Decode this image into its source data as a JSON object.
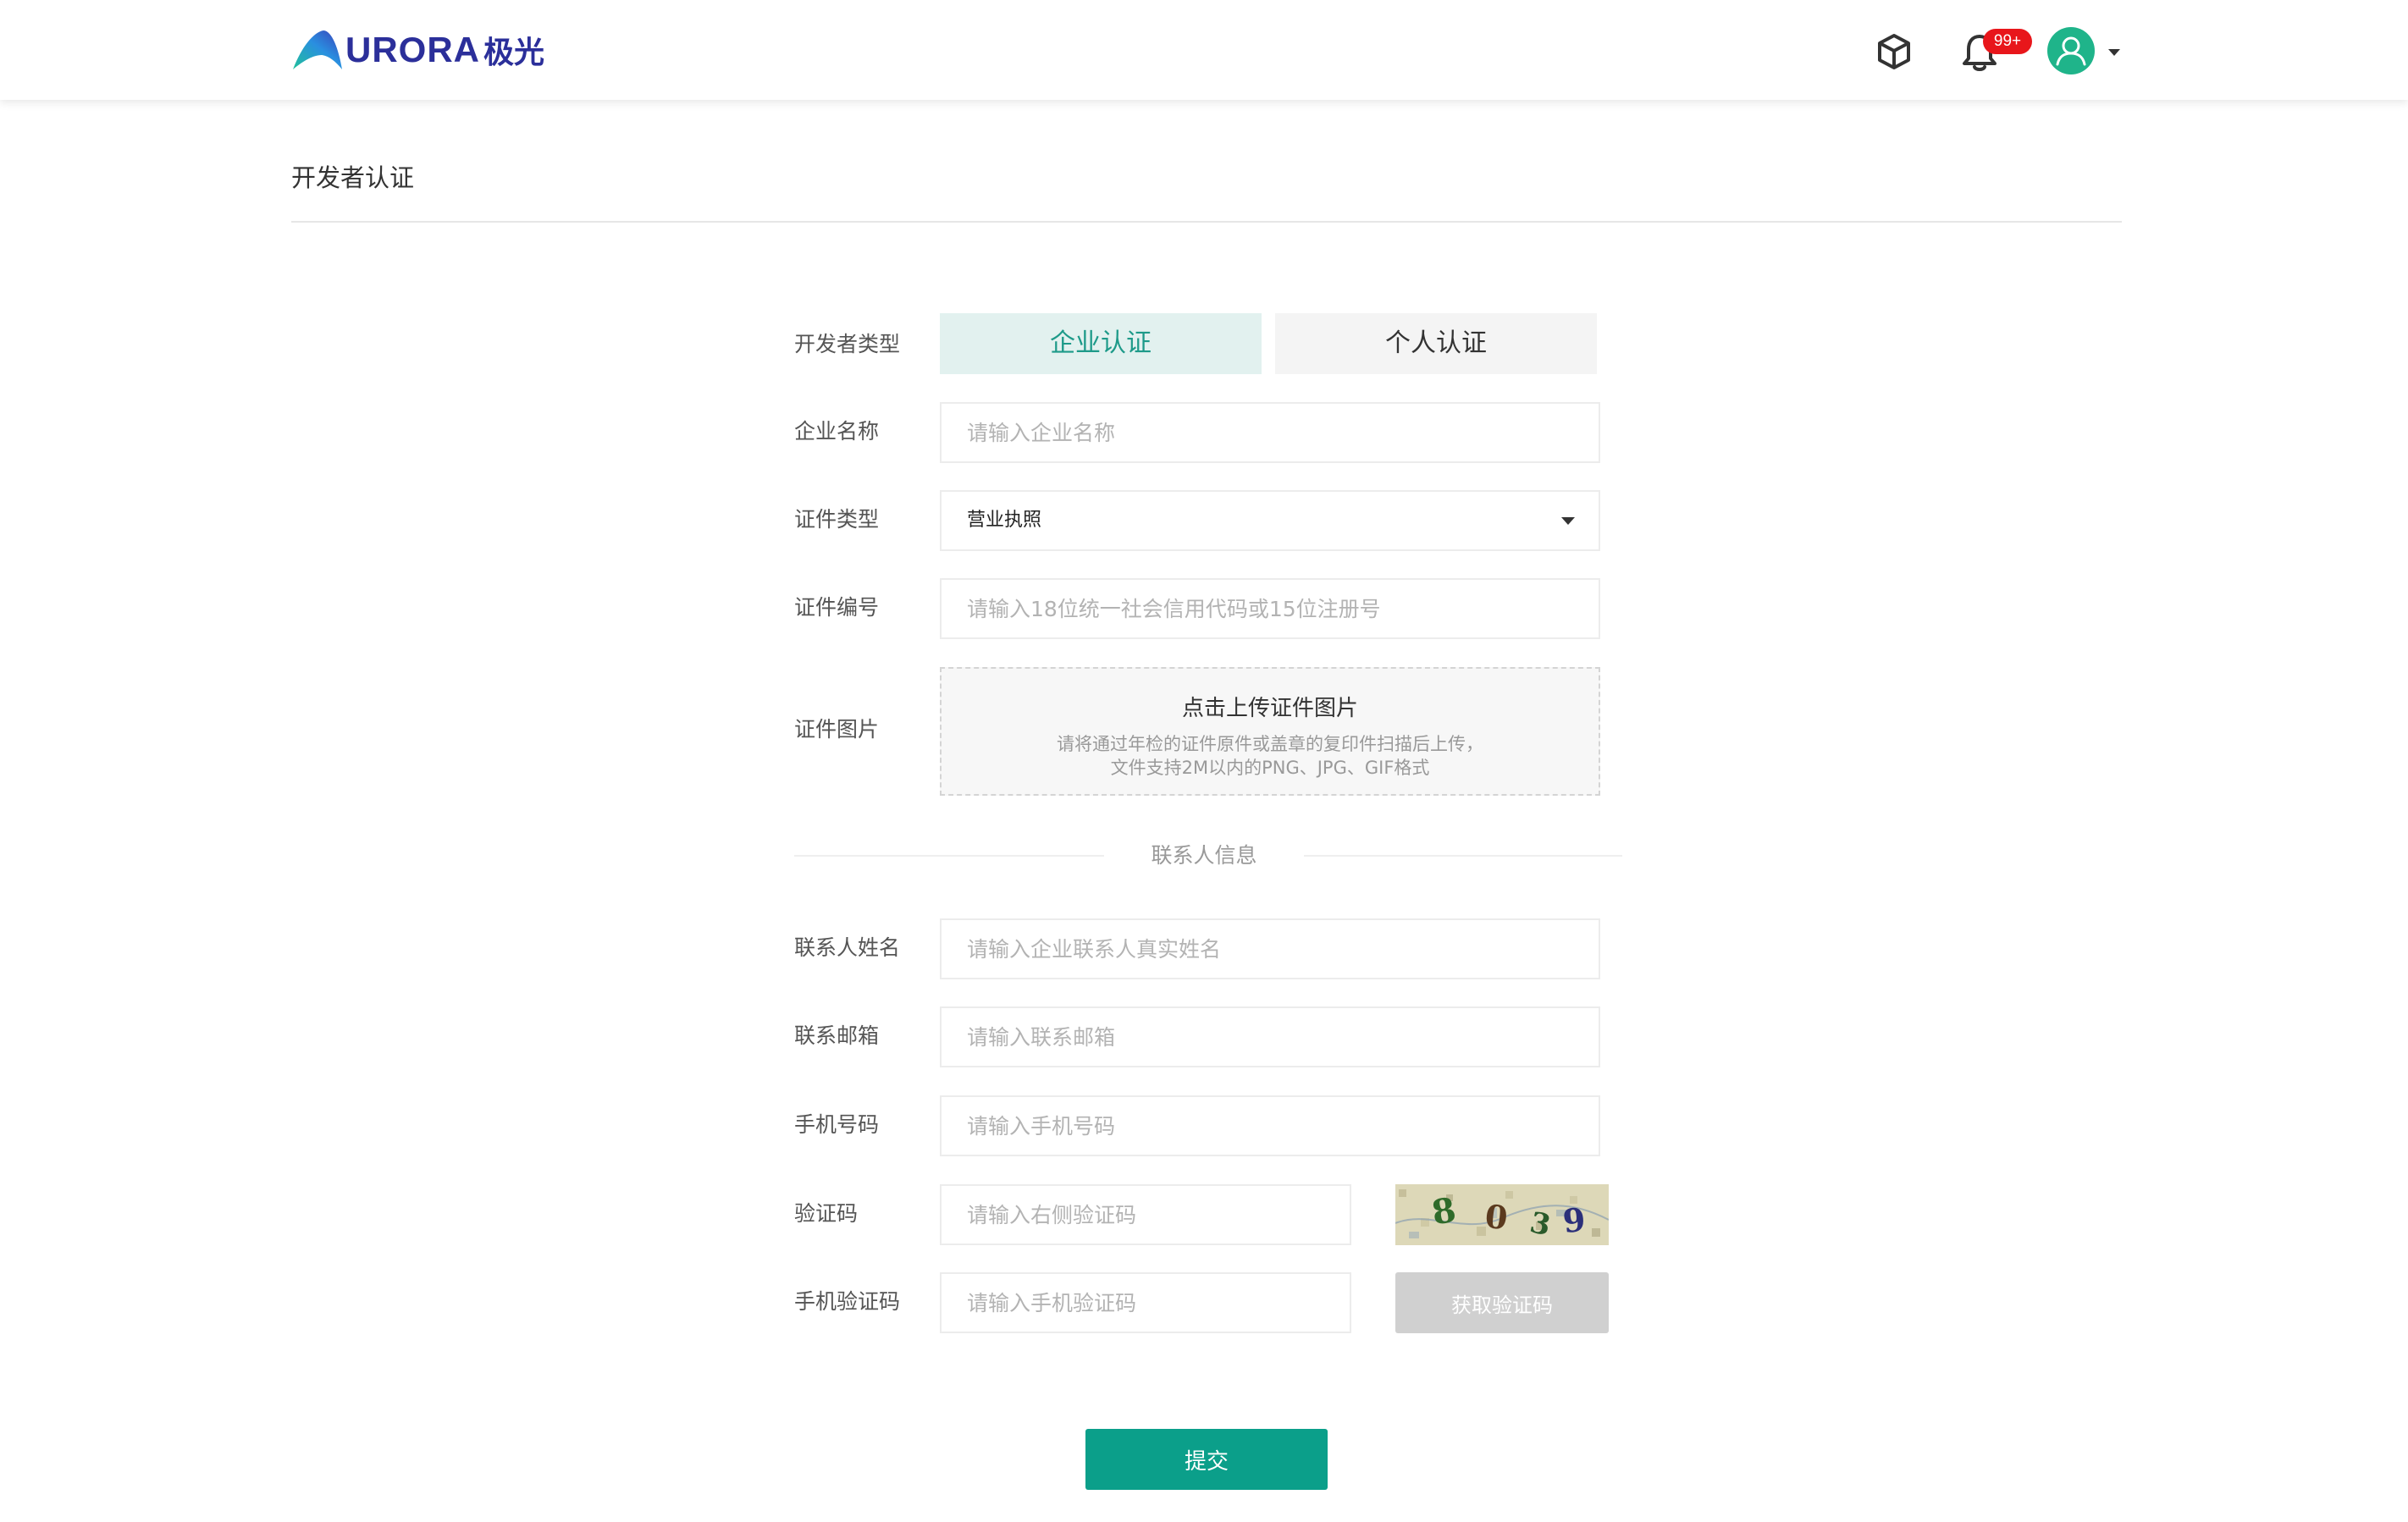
{
  "header": {
    "logo_word": "URORA",
    "logo_cn": "极光",
    "notification_badge": "99+",
    "icons": {
      "product": "cube-icon",
      "notifications": "bell-icon",
      "user": "user-avatar-icon",
      "user_menu": "caret-down-icon"
    }
  },
  "page": {
    "title": "开发者认证"
  },
  "form": {
    "developer_type": {
      "label": "开发者类型",
      "options": [
        "企业认证",
        "个人认证"
      ],
      "selected": "企业认证"
    },
    "company_name": {
      "label": "企业名称",
      "placeholder": "请输入企业名称"
    },
    "cert_type": {
      "label": "证件类型",
      "value": "营业执照"
    },
    "cert_number": {
      "label": "证件编号",
      "placeholder": "请输入18位统一社会信用代码或15位注册号"
    },
    "cert_image": {
      "label": "证件图片",
      "title": "点击上传证件图片",
      "hint_line1": "请将通过年检的证件原件或盖章的复印件扫描后上传，",
      "hint_line2": "文件支持2M以内的PNG、JPG、GIF格式"
    },
    "contact_section_title": "联系人信息",
    "contact_name": {
      "label": "联系人姓名",
      "placeholder": "请输入企业联系人真实姓名"
    },
    "contact_email": {
      "label": "联系邮箱",
      "placeholder": "请输入联系邮箱"
    },
    "phone": {
      "label": "手机号码",
      "placeholder": "请输入手机号码"
    },
    "captcha": {
      "label": "验证码",
      "placeholder": "请输入右侧验证码",
      "image_text": "8039"
    },
    "sms_code": {
      "label": "手机验证码",
      "placeholder": "请输入手机验证码",
      "button": "获取验证码"
    },
    "submit": "提交"
  },
  "colors": {
    "brand_dark": "#2b2f9a",
    "accent_green": "#0b9f8a",
    "selected_tab_bg": "#e2f1ef",
    "badge_red": "#e8161b",
    "disabled_button": "#d0d0d0"
  }
}
